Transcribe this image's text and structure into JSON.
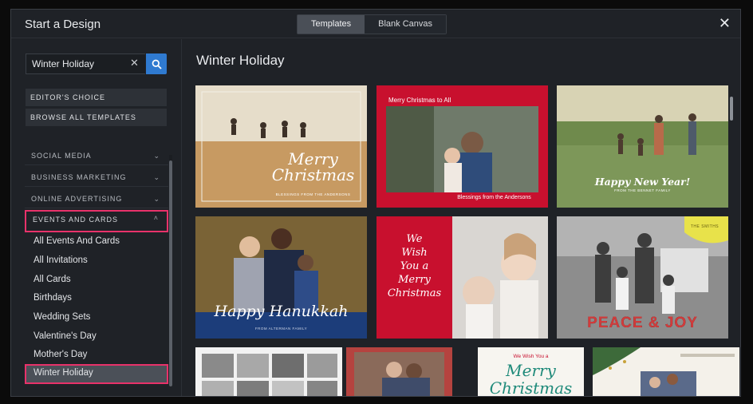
{
  "header": {
    "title": "Start a Design",
    "tabs": [
      "Templates",
      "Blank Canvas"
    ],
    "active_tab": "Templates",
    "close_icon": "close-icon"
  },
  "search": {
    "value": "Winter Holiday",
    "clear_icon": "clear-icon",
    "icon": "search-icon"
  },
  "menu": {
    "editors_choice": "EDITOR'S CHOICE",
    "browse_all": "BROWSE ALL TEMPLATES"
  },
  "categories": [
    "SOCIAL MEDIA",
    "BUSINESS MARKETING",
    "ONLINE ADVERTISING",
    "EVENTS AND CARDS"
  ],
  "open_category": "EVENTS AND CARDS",
  "subcategories": [
    "All Events And Cards",
    "All Invitations",
    "All Cards",
    "Birthdays",
    "Wedding Sets",
    "Valentine's Day",
    "Mother's Day",
    "Winter Holiday"
  ],
  "active_subcategory": "Winter Holiday",
  "main": {
    "heading": "Winter Holiday"
  },
  "templates": [
    {
      "title": "Merry Christmas",
      "caption": "BLESSINGS FROM THE ANDERSONS"
    },
    {
      "title": "Merry Christmas to All",
      "caption": "Blessings from the Andersons"
    },
    {
      "title": "Happy New Year!",
      "caption": "FROM THE BENNET FAMILY"
    },
    {
      "title": "Happy Hanukkah",
      "caption": "FROM ALTERMAN FAMILY"
    },
    {
      "title": "We Wish You a Merry Christmas",
      "lines": [
        "We",
        "Wish",
        "You a",
        "Merry",
        "Christmas"
      ]
    },
    {
      "title": "PEACE & JOY",
      "badge": "THE SMITHS"
    },
    {
      "title": ""
    },
    {
      "title": ""
    },
    {
      "title": "Merry Christmas",
      "caption": "We Wish You a",
      "line1": "Merry",
      "line2": "Christmas"
    },
    {
      "title": ""
    }
  ],
  "colors": {
    "accent": "#2f7ad0",
    "highlight": "#e8326a",
    "card_red": "#c8102e",
    "navy": "#1c3d7a"
  }
}
